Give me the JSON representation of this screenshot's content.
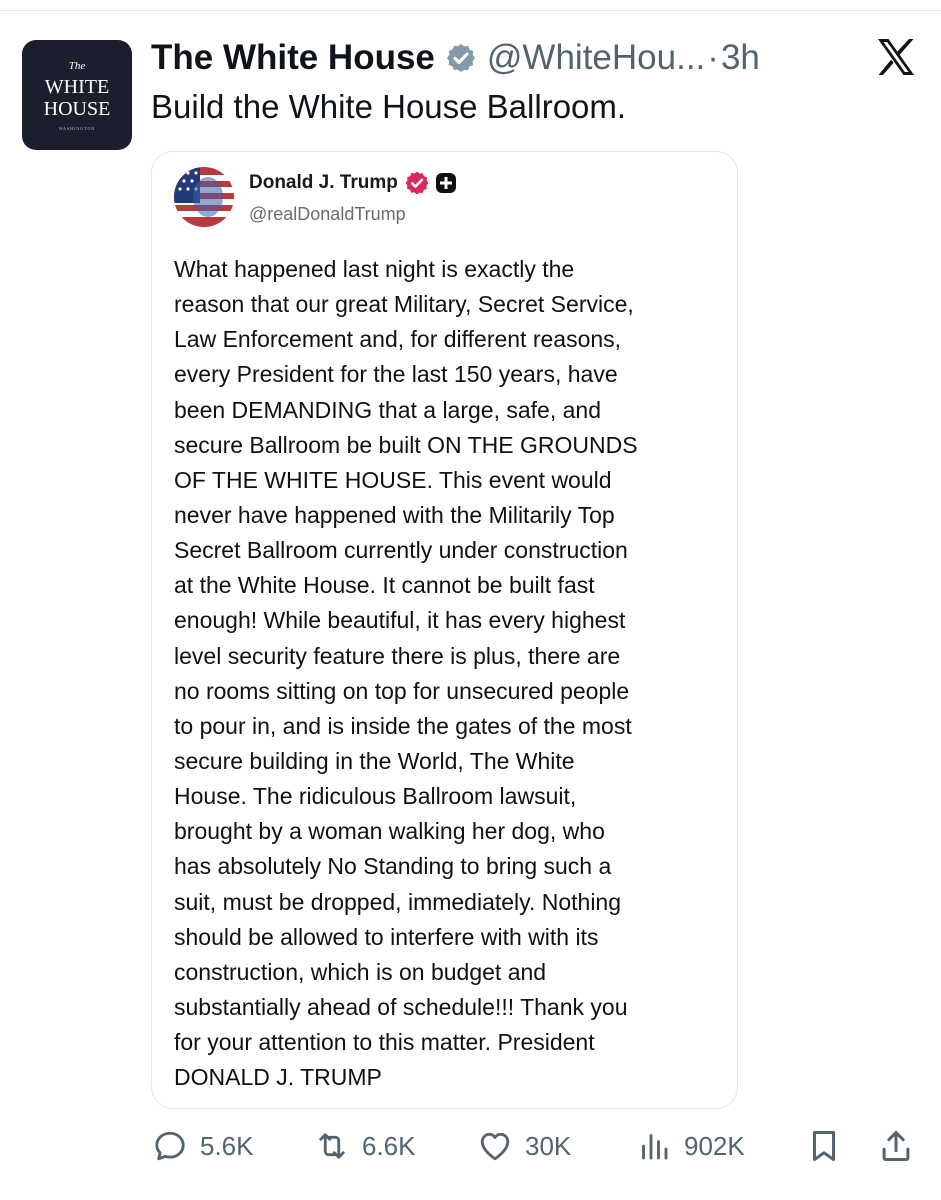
{
  "author": {
    "name": "The White House",
    "handle": "@WhiteHou...",
    "separator": "·",
    "time": "3h",
    "avatar_text": {
      "line1": "The",
      "line2": "WHITE",
      "line3": "HOUSE",
      "line4": "WASHINGTON"
    }
  },
  "tweet": {
    "text": "Build the White House Ballroom."
  },
  "quoted": {
    "name": "Donald J. Trump",
    "handle": "@realDonaldTrump",
    "lines": [
      "What happened last night is exactly the",
      "reason that our great Military, Secret Service,",
      "Law Enforcement and, for different reasons,",
      "every President for the last 150 years, have",
      "been DEMANDING that a large, safe, and",
      "secure Ballroom be built ON THE GROUNDS",
      "OF THE WHITE HOUSE. This event would",
      "never have happened with the Militarily Top",
      "Secret Ballroom currently under construction",
      "at the White House. It cannot be built fast",
      "enough! While beautiful, it has every highest",
      "level security feature there is plus, there are",
      "no rooms sitting on top for unsecured people",
      "to pour in, and is inside the gates of the most",
      "secure building in the World, The White",
      "House. The ridiculous Ballroom lawsuit,",
      "brought by a woman walking her dog, who",
      "has absolutely No Standing to bring such a",
      "suit, must be dropped, immediately. Nothing",
      "should be allowed to interfere with with its",
      "construction, which is on budget and",
      "substantially ahead of schedule!!! Thank you",
      "for your attention to this matter. President",
      "DONALD J. TRUMP"
    ]
  },
  "actions": {
    "replies": "5.6K",
    "reposts": "6.6K",
    "likes": "30K",
    "views": "902K"
  },
  "icons": {
    "verified_badge": "verified-gray-icon",
    "quoted_verified_badge": "verified-pink-icon",
    "quoted_plus_badge": "plus-badge-icon",
    "close": "x-logo-icon",
    "reply": "reply-icon",
    "repost": "repost-icon",
    "like": "heart-icon",
    "views": "views-icon",
    "bookmark": "bookmark-icon",
    "share": "share-icon"
  },
  "colors": {
    "text": "#0f1419",
    "secondary": "#536471",
    "verified_gray": "#829aab",
    "verified_pink": "#e0245e",
    "avatar_bg": "#1b1f2d"
  }
}
